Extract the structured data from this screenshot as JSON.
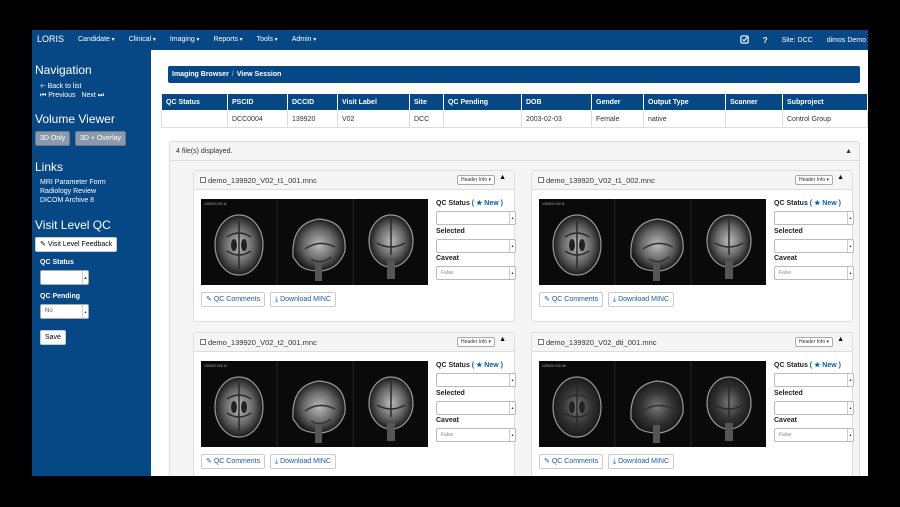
{
  "topnav": {
    "brand": "LORIS",
    "menus": [
      "Candidate",
      "Clinical",
      "Imaging",
      "Reports",
      "Tools",
      "Admin"
    ],
    "check_icon": "checkbox-icon",
    "help": "?",
    "site": "Site: DCC",
    "user": "dimos Demo"
  },
  "sidebar": {
    "nav_title": "Navigation",
    "back_to_list": "Back to list",
    "previous": "Previous",
    "next": "Next",
    "volume_viewer_title": "Volume Viewer",
    "btn_3d_only": "3D Only",
    "btn_3d_overlay": "3D + Overlay",
    "links_title": "Links",
    "links": [
      "MRI Parameter Form",
      "Radiology Review",
      "DICOM Archive 8"
    ],
    "visit_qc_title": "Visit Level QC",
    "visit_feedback": "Visit Level Feedback",
    "qc_status_label": "QC Status",
    "qc_status_value": "",
    "qc_pending_label": "QC Pending",
    "qc_pending_value": "No",
    "save": "Save"
  },
  "breadcrumb": {
    "items": [
      "Imaging Browser",
      "View Session"
    ],
    "separator": "/"
  },
  "session_table": {
    "headers": [
      "QC Status",
      "PSCID",
      "DCCID",
      "Visit Label",
      "Site",
      "QC Pending",
      "DOB",
      "Gender",
      "Output Type",
      "Scanner",
      "Subproject"
    ],
    "row": [
      "",
      "DCC0004",
      "139920",
      "V02",
      "DCC",
      "",
      "2003-02-03",
      "Female",
      "native",
      "",
      "Control Group"
    ]
  },
  "files_panel": {
    "header": "4 file(s) displayed.",
    "caret": "▲"
  },
  "files": [
    {
      "name": "demo_139920_V02_t1_001.mnc",
      "header_info": "Header Info ▾",
      "image_label": "139920.V02.t1",
      "qc_status_label": "QC Status",
      "qc_new": "( ★ New )",
      "selected_label": "Selected",
      "caveat_label": "Caveat",
      "caveat_value": "False",
      "qc_comments": "QC Comments",
      "download": "Download MINC"
    },
    {
      "name": "demo_139920_V02_t1_002.mnc",
      "header_info": "Header Info ▾",
      "image_label": "139920.V02.t1",
      "qc_status_label": "QC Status",
      "qc_new": "( ★ New )",
      "selected_label": "Selected",
      "caveat_label": "Caveat",
      "caveat_value": "False",
      "qc_comments": "QC Comments",
      "download": "Download MINC"
    },
    {
      "name": "demo_139920_V02_t2_001.mnc",
      "header_info": "Header Info ▾",
      "image_label": "139920.V02.t2",
      "qc_status_label": "QC Status",
      "qc_new": "( ★ New )",
      "selected_label": "Selected",
      "caveat_label": "Caveat",
      "caveat_value": "False",
      "qc_comments": "QC Comments",
      "download": "Download MINC"
    },
    {
      "name": "demo_139920_V02_dti_001.mnc",
      "header_info": "Header Info ▾",
      "image_label": "139920.V02.dti",
      "qc_status_label": "QC Status",
      "qc_new": "( ★ New )",
      "selected_label": "Selected",
      "caveat_label": "Caveat",
      "caveat_value": "False",
      "qc_comments": "QC Comments",
      "download": "Download MINC"
    }
  ],
  "colors": {
    "brand_blue": "#064785",
    "link_blue": "#1b5aa0"
  }
}
